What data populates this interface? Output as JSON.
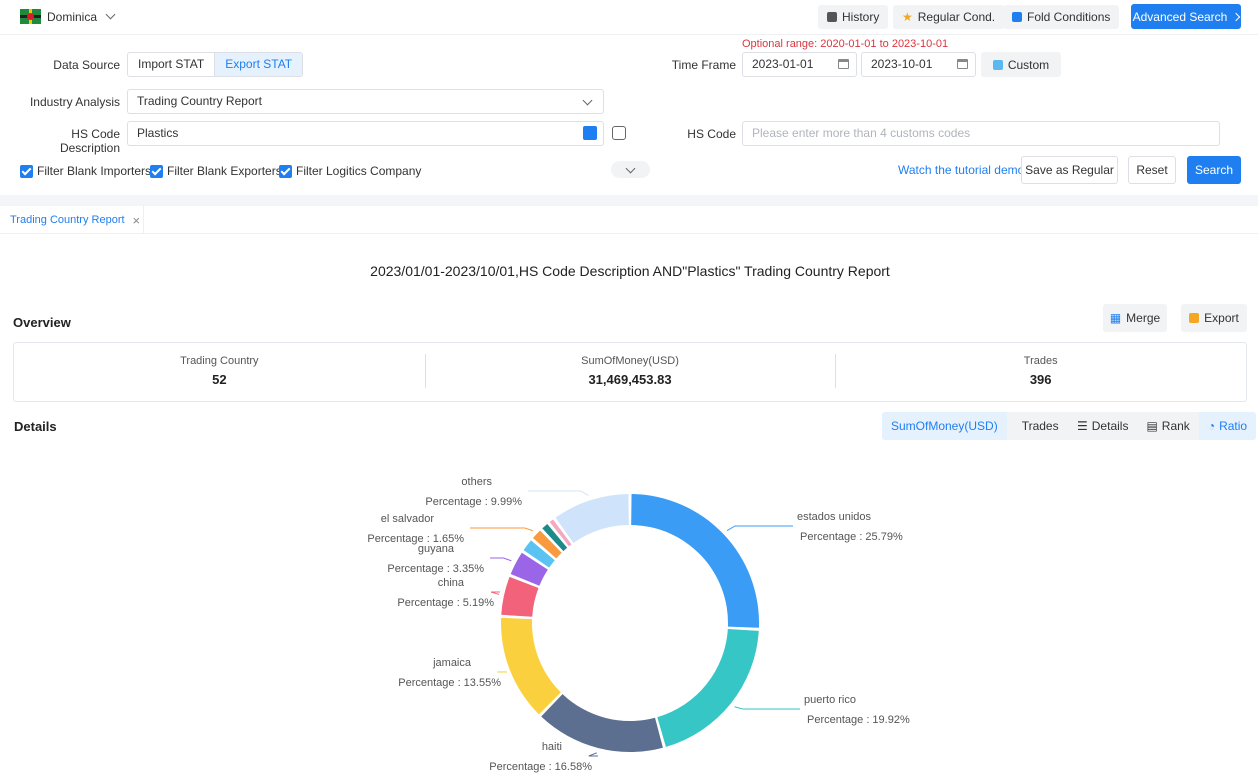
{
  "topbar": {
    "country": "Dominica",
    "history": "History",
    "regular_cond": "Regular Cond.",
    "fold_conditions": "Fold Conditions",
    "advanced_search": "Advanced Search"
  },
  "filters": {
    "optional_range": "Optional range:  2020-01-01 to 2023-10-01",
    "data_source_label": "Data Source",
    "import_stat": "Import STAT",
    "export_stat": "Export STAT",
    "time_frame_label": "Time Frame",
    "date_from": "2023-01-01",
    "date_to": "2023-10-01",
    "custom": "Custom",
    "industry_label": "Industry Analysis",
    "industry_value": "Trading Country Report",
    "hs_desc_label": "HS Code Description",
    "hs_desc_value": "Plastics",
    "hs_code_label": "HS Code",
    "hs_code_placeholder": "Please enter more than 4 customs codes",
    "filter_importers": "Filter Blank Importers",
    "filter_exporters": "Filter Blank Exporters",
    "filter_logistics": "Filter Logitics Company",
    "tutorial": "Watch the tutorial demo",
    "save_regular": "Save as Regular",
    "reset": "Reset",
    "search": "Search"
  },
  "tab": {
    "label": "Trading Country Report"
  },
  "report": {
    "title": "2023/01/01-2023/10/01,HS Code Description AND\"Plastics\" Trading Country Report"
  },
  "overview": {
    "title": "Overview",
    "merge": "Merge",
    "export": "Export",
    "items": [
      {
        "label": "Trading Country",
        "value": "52"
      },
      {
        "label": "SumOfMoney(USD)",
        "value": "31,469,453.83"
      },
      {
        "label": "Trades",
        "value": "396"
      }
    ]
  },
  "details": {
    "title": "Details",
    "metric_money": "SumOfMoney(USD)",
    "metric_trades": "Trades",
    "view_details": "Details",
    "view_rank": "Rank",
    "view_ratio": "Ratio"
  },
  "chart_data": {
    "type": "pie",
    "percent_prefix": "Percentage",
    "slices": [
      {
        "name": "estados unidos",
        "value": 25.79,
        "label": "25.79%",
        "color": "#3a9cf5"
      },
      {
        "name": "puerto rico",
        "value": 19.92,
        "label": "19.92%",
        "color": "#36c6c6"
      },
      {
        "name": "haiti",
        "value": 16.58,
        "label": "16.58%",
        "color": "#5c6f91"
      },
      {
        "name": "jamaica",
        "value": 13.55,
        "label": "13.55%",
        "color": "#fbd03e"
      },
      {
        "name": "china",
        "value": 5.19,
        "label": "5.19%",
        "color": "#f2637b"
      },
      {
        "name": "guyana",
        "value": 3.35,
        "label": "3.35%",
        "color": "#9a65e6"
      },
      {
        "name": "",
        "value": 1.9,
        "label": "",
        "color": "#5bc3f2"
      },
      {
        "name": "el salvador",
        "value": 1.65,
        "label": "1.65%",
        "color": "#f99a3e"
      },
      {
        "name": "",
        "value": 1.2,
        "label": "",
        "color": "#1f8a8a"
      },
      {
        "name": "",
        "value": 0.9,
        "label": "",
        "color": "#f4a9c0"
      },
      {
        "name": "others",
        "value": 9.99,
        "label": "9.99%",
        "color": "#cfe4fb"
      }
    ]
  }
}
